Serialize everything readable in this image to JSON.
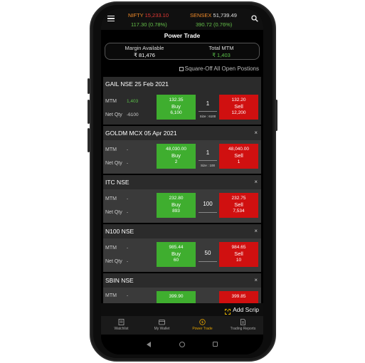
{
  "header": {
    "nifty_name": "NIFTY",
    "nifty_value": "15,233.10",
    "nifty_change": "117.30 (0.78%)",
    "sensex_name": "SENSEX",
    "sensex_value": "51,739.49",
    "sensex_change": "390.72 (0.76%)"
  },
  "page_title": "Power Trade",
  "summary": {
    "margin_label": "Margin Available",
    "margin_value": "₹ 81,476",
    "mtm_label": "Total MTM",
    "mtm_value": "₹ 1,403"
  },
  "square_off_label": "Square-Off All Open Postions",
  "cards": [
    {
      "title": "GAIL NSE 25 Feb 2021",
      "mtm_label": "MTM",
      "mtm_value": "1,403",
      "net_label": "Net Qty",
      "net_value": "-6100",
      "buy_price": "132.35",
      "buy_label": "Buy",
      "buy_qty": "6,100",
      "qty": "1",
      "size": "Size : 6100",
      "sell_price": "132.20",
      "sell_label": "Sell",
      "sell_qty": "12,200",
      "close": ""
    },
    {
      "title": "GOLDM MCX 05 Apr 2021",
      "mtm_label": "MTM",
      "mtm_value": "-",
      "net_label": "Net Qty",
      "net_value": "-",
      "buy_price": "48,030.00",
      "buy_label": "Buy",
      "buy_qty": "2",
      "qty": "1",
      "size": "Size : 100",
      "sell_price": "48,040.00",
      "sell_label": "Sell",
      "sell_qty": "1",
      "close": "×"
    },
    {
      "title": "ITC NSE",
      "mtm_label": "MTM",
      "mtm_value": "-",
      "net_label": "Net Qty",
      "net_value": "-",
      "buy_price": "232.80",
      "buy_label": "Buy",
      "buy_qty": "893",
      "qty": "100",
      "size": "",
      "sell_price": "232.75",
      "sell_label": "Sell",
      "sell_qty": "7,534",
      "close": "×"
    },
    {
      "title": "N100 NSE",
      "mtm_label": "MTM",
      "mtm_value": "-",
      "net_label": "Net Qty",
      "net_value": "-",
      "buy_price": "985.44",
      "buy_label": "Buy",
      "buy_qty": "60",
      "qty": "50",
      "size": "",
      "sell_price": "984.65",
      "sell_label": "Sell",
      "sell_qty": "10",
      "close": "×"
    },
    {
      "title": "SBIN NSE",
      "mtm_label": "MTM",
      "mtm_value": "-",
      "net_label": "",
      "net_value": "",
      "buy_price": "399.90",
      "buy_label": "",
      "buy_qty": "",
      "qty": "",
      "size": "",
      "sell_price": "399.85",
      "sell_label": "",
      "sell_qty": "",
      "close": "×"
    }
  ],
  "add_scrip_label": "Add Scrip",
  "bottom_nav": [
    {
      "label": "Watchlist",
      "icon": "watchlist-icon"
    },
    {
      "label": "My Wallet",
      "icon": "wallet-icon"
    },
    {
      "label": "Power Trade",
      "icon": "power-trade-icon"
    },
    {
      "label": "Trading Reports",
      "icon": "reports-icon"
    }
  ],
  "colors": {
    "buy": "#3fae2f",
    "sell": "#d01010",
    "accent": "#e0a000",
    "nifty": "#f08a28"
  }
}
